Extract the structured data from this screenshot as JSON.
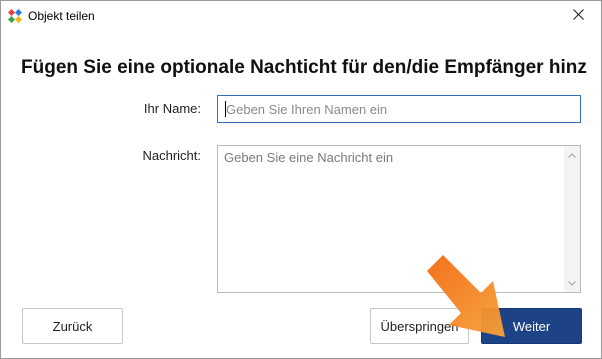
{
  "window": {
    "title": "Objekt teilen",
    "close_icon": "close-icon"
  },
  "heading": "Fügen Sie eine optionale Nachticht für den/die Empfänger hinz",
  "form": {
    "name_label": "Ihr Name:",
    "name_placeholder": "Geben Sie Ihren Namen ein",
    "name_value": "",
    "message_label": "Nachricht:",
    "message_placeholder": "Geben Sie eine Nachricht ein",
    "message_value": ""
  },
  "buttons": {
    "back": "Zurück",
    "skip": "Überspringen",
    "next": "Weiter"
  },
  "colors": {
    "primary_button": "#1d4386",
    "input_focus_border": "#2f6fbf",
    "annotation_arrow": "#f07a1a"
  },
  "icons": {
    "app": "app-logo-icon",
    "scroll_up": "chevron-up-icon",
    "scroll_down": "chevron-down-icon",
    "annotation": "pointer-arrow-icon"
  }
}
